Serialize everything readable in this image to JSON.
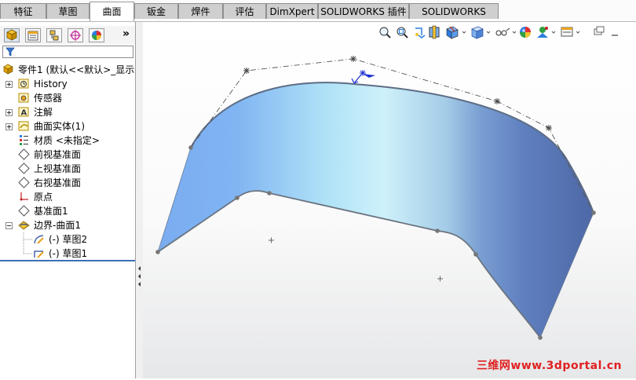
{
  "tabs": [
    {
      "label": "特征"
    },
    {
      "label": "草图"
    },
    {
      "label": "曲面"
    },
    {
      "label": "钣金"
    },
    {
      "label": "焊件"
    },
    {
      "label": "评估"
    },
    {
      "label": "DimXpert"
    },
    {
      "label": "SOLIDWORKS 插件"
    },
    {
      "label": "SOLIDWORKS MBD"
    }
  ],
  "feature_manager": {
    "toolbar_more": "»",
    "tree": [
      {
        "label": "零件1  (默认<<默认>_显示"
      },
      {
        "label": "History"
      },
      {
        "label": "传感器"
      },
      {
        "label": "注解"
      },
      {
        "label": "曲面实体(1)"
      },
      {
        "label": "材质 <未指定>"
      },
      {
        "label": "前视基准面"
      },
      {
        "label": "上视基准面"
      },
      {
        "label": "右视基准面"
      },
      {
        "label": "原点"
      },
      {
        "label": "基准面1"
      },
      {
        "label": "边界-曲面1"
      },
      {
        "label": "(-) 草图2"
      },
      {
        "label": "(-) 草图1"
      }
    ]
  },
  "watermark": "三维网www.3dportal.cn",
  "colors": {
    "surface_light": "#c9eef8",
    "surface_blue": "#6fa4ec",
    "surface_dark": "#5673a9",
    "active_tab_bg": "#ffffff",
    "tab_bg": "#cfcfcf",
    "panel_divider": "#3b6fb6",
    "watermark": "#e02020"
  }
}
